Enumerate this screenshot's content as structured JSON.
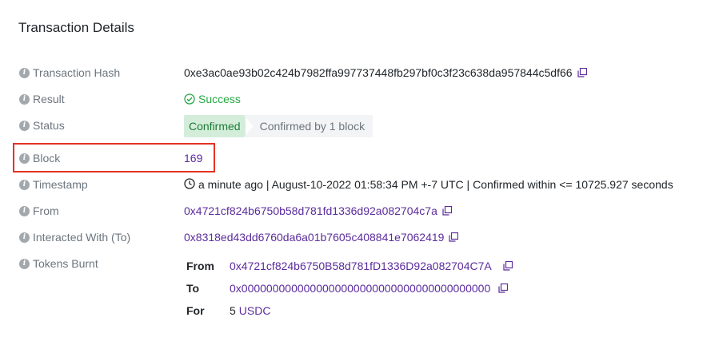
{
  "title": "Transaction Details",
  "rows": {
    "tx_hash": {
      "label": "Transaction Hash",
      "value": "0xe3ac0ae93b02c424b7982ffa997737448fb297bf0c3f23c638da957844c5df66"
    },
    "result": {
      "label": "Result",
      "value": "Success"
    },
    "status": {
      "label": "Status",
      "confirmed": "Confirmed",
      "confirmed_by": "Confirmed by 1 block"
    },
    "block": {
      "label": "Block",
      "value": "169"
    },
    "timestamp": {
      "label": "Timestamp",
      "value": "a minute ago | August-10-2022 01:58:34 PM +-7 UTC | Confirmed within <= 10725.927 seconds"
    },
    "from": {
      "label": "From",
      "value": "0x4721cf824b6750b58d781fd1336d92a082704c7a"
    },
    "interacted_with": {
      "label": "Interacted With (To)",
      "value": "0x8318ed43dd6760da6a01b7605c408841e7062419"
    },
    "tokens_burnt": {
      "label": "Tokens Burnt",
      "from_key": "From",
      "from_value": "0x4721cf824b6750B58d781fD1336D92a082704C7A",
      "to_key": "To",
      "to_value": "0x0000000000000000000000000000000000000000",
      "for_key": "For",
      "for_amount": "5",
      "for_token": "USDC"
    }
  },
  "colors": {
    "link": "#5b2c9c",
    "success": "#28a745",
    "highlight": "#e53224"
  },
  "icons": [
    "info-icon",
    "copy-icon",
    "check-circle-icon",
    "clock-icon"
  ]
}
